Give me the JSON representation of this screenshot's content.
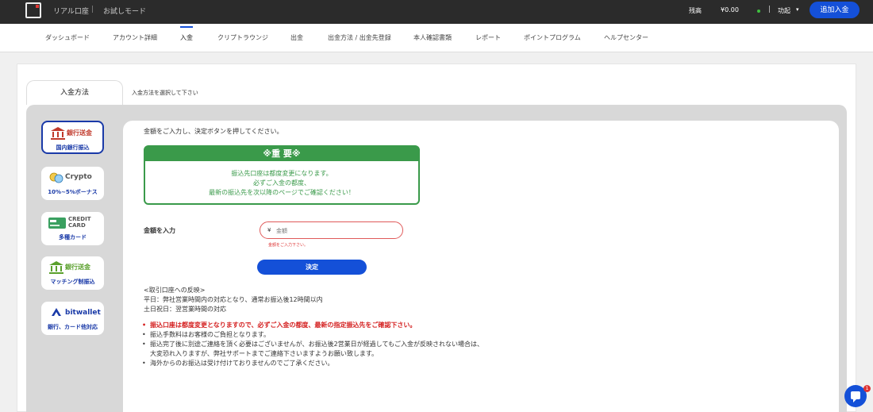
{
  "topbar": {
    "account_type": "リアル口座",
    "separator": "|",
    "demo_mode": "お試しモード",
    "balance_label": "残高",
    "balance_value": "¥0.00",
    "functions_label": "功起",
    "deposit_button": "追加入金"
  },
  "nav": {
    "items": [
      {
        "label": "ダッシュボード"
      },
      {
        "label": "アカウント詳細"
      },
      {
        "label": "入金"
      },
      {
        "label": "クリプトラウンジ"
      },
      {
        "label": "出金"
      },
      {
        "label": "出金方法 / 出金先登録"
      },
      {
        "label": "本人確認書類"
      },
      {
        "label": "レポート"
      },
      {
        "label": "ポイントプログラム"
      },
      {
        "label": "ヘルプセンター"
      }
    ],
    "active": "入金"
  },
  "tabs": {
    "active_tab": "入金方法",
    "hint": "入金方法を選択して下さい"
  },
  "methods": [
    {
      "title": "銀行送金",
      "subtitle": "国内銀行振込"
    },
    {
      "title": "Crypto",
      "subtitle": "10%~5%ボーナス"
    },
    {
      "title": "CREDIT CARD",
      "subtitle": "多種カード"
    },
    {
      "title": "銀行送金",
      "subtitle": "マッチング制振込"
    },
    {
      "title": "bitwallet",
      "subtitle": "銀行、カード他対応"
    }
  ],
  "content": {
    "intro": "金額をご入力し、決定ボタンを押してください。",
    "notice": {
      "heading": "※重 要※",
      "lines": [
        "振込先口座は都度変更になります。",
        "必ずご入金の都度、",
        "最新の振込先を次以降のページでご確認ください！"
      ]
    },
    "amount_label": "金額を入力",
    "currency_symbol": "¥",
    "amount_placeholder": "金額",
    "amount_error": "金額をご入力下さい。",
    "submit_button": "決定",
    "reflect": [
      "<取引口座への反映>",
      "平日：弊社営業時間内の対応となり、通常お振込後12時間以内",
      "土日祝日：翌営業時間の対応"
    ],
    "bullets": [
      "振込口座は都度変更となりますので、必ずご入金の都度、最新の指定振込先をご確認下さい。",
      "振込手数料はお客様のご負担となります。",
      "振込完了後に別途ご連絡を頂く必要はございませんが、お振込後2営業日が経過してもご入金が反映されない場合は、",
      "大変恐れ入りますが、弊社サポートまでご連絡下さいますようお願い致します。",
      "海外からのお振込は受け付けておりませんのでご了承ください。"
    ]
  },
  "chat": {
    "badge": "1"
  },
  "colors": {
    "brand_blue": "#1450d8",
    "notice_green": "#3a9a4a",
    "warning_red": "#d41f1f"
  }
}
